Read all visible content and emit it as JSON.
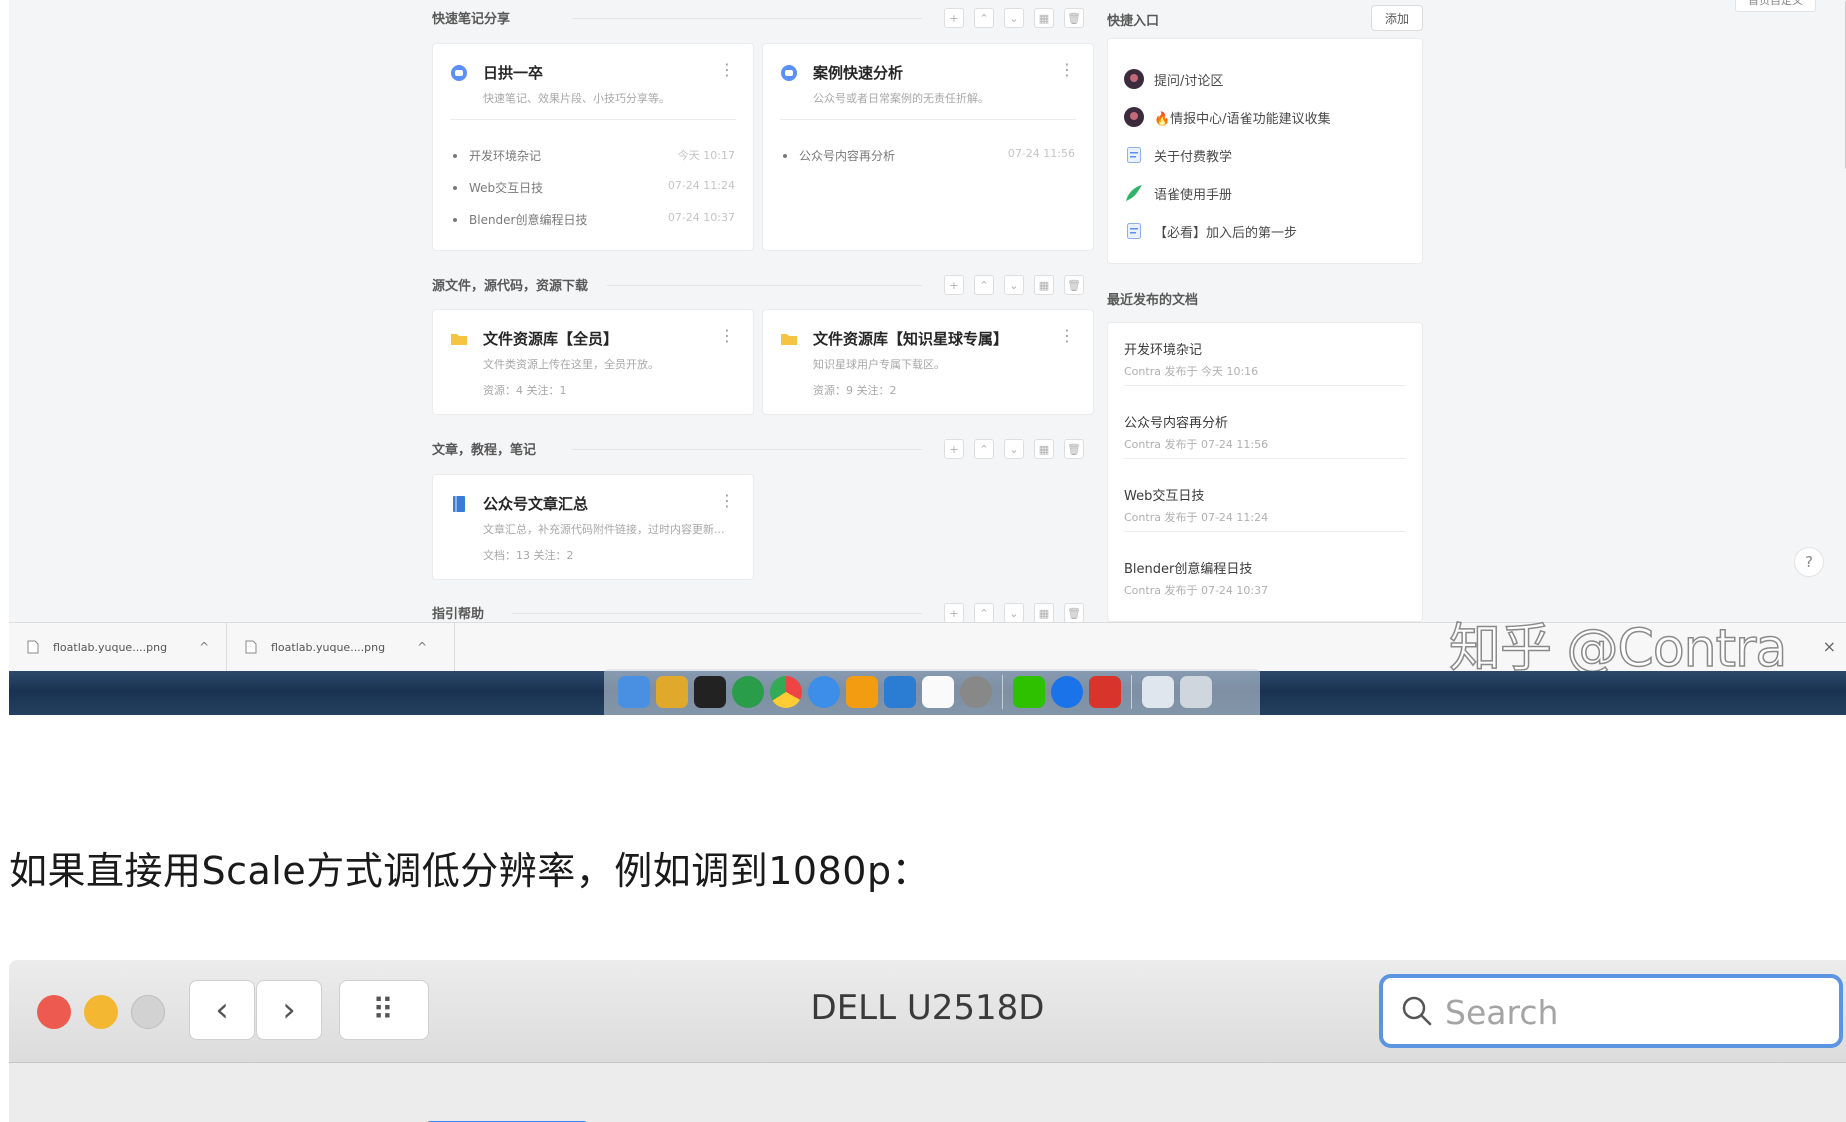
{
  "screenshot": {
    "top_right_button": "首页自定义",
    "sections": {
      "quick_notes": {
        "title": "快速笔记分享",
        "cards": [
          {
            "title": "日拱一卒",
            "desc": "快速笔记、效果片段、小技巧分享等。",
            "items": [
              {
                "name": "开发环境杂记",
                "time": "今天 10:17"
              },
              {
                "name": "Web交互日技",
                "time": "07-24 11:24"
              },
              {
                "name": "Blender创意编程日技",
                "time": "07-24 10:37"
              }
            ]
          },
          {
            "title": "案例快速分析",
            "desc": "公众号或者日常案例的无责任折解。",
            "items": [
              {
                "name": "公众号内容再分析",
                "time": "07-24 11:56"
              }
            ]
          }
        ]
      },
      "source_files": {
        "title": "源文件，源代码，资源下载",
        "cards": [
          {
            "title": "文件资源库【全员】",
            "desc": "文件类资源上传在这里，全员开放。",
            "meta": "资源：4   关注：1"
          },
          {
            "title": "文件资源库【知识星球专属】",
            "desc": "知识星球用户专属下载区。",
            "meta": "资源：9   关注：2"
          }
        ]
      },
      "articles": {
        "title": "文章，教程，笔记",
        "cards": [
          {
            "title": "公众号文章汇总",
            "desc": "文章汇总，补充源代码附件链接，过时内容更新...",
            "meta": "文档：13   关注：2"
          }
        ]
      },
      "help": {
        "title": "指引帮助"
      }
    },
    "tool_glyphs": [
      "+",
      "⌃",
      "⌄",
      "▦",
      "🗑"
    ],
    "quick_entry": {
      "title": "快捷入口",
      "add_label": "添加",
      "items": [
        {
          "label": "提问/讨论区",
          "icon": "avatar-icon"
        },
        {
          "label": "🔥情报中心/语雀功能建议收集",
          "icon": "avatar-icon"
        },
        {
          "label": "关于付费教学",
          "icon": "doc-icon"
        },
        {
          "label": "语雀使用手册",
          "icon": "yuque-icon"
        },
        {
          "label": "【必看】加入后的第一步",
          "icon": "doc-icon"
        }
      ]
    },
    "recent_docs": {
      "title": "最近发布的文档",
      "items": [
        {
          "title": "开发环境杂记",
          "meta": "Contra 发布于 今天 10:16"
        },
        {
          "title": "公众号内容再分析",
          "meta": "Contra 发布于 07-24 11:56"
        },
        {
          "title": "Web交互日技",
          "meta": "Contra 发布于 07-24 11:24"
        },
        {
          "title": "Blender创意编程日技",
          "meta": "Contra 发布于 07-24 10:37"
        }
      ]
    },
    "help_button": "?",
    "downloads": [
      {
        "name": "floatlab.yuque....png",
        "chevron": "^"
      },
      {
        "name": "floatlab.yuque....png",
        "chevron": "^"
      }
    ],
    "downloads_close": "×",
    "watermark": "知乎 @Contra"
  },
  "caption": "如果直接用Scale方式调低分辨率，例如调到1080p：",
  "window": {
    "title": "DELL U2518D",
    "back_glyph": "‹",
    "forward_glyph": "›",
    "grid_glyph": "⠿",
    "search_placeholder": "Search"
  },
  "colors": {
    "accent_blue": "#5b94e0",
    "close_red": "#ed5b50",
    "minimize_yellow": "#f4b731",
    "folder_yellow": "#f5c542",
    "book_blue": "#3a7bd5"
  }
}
